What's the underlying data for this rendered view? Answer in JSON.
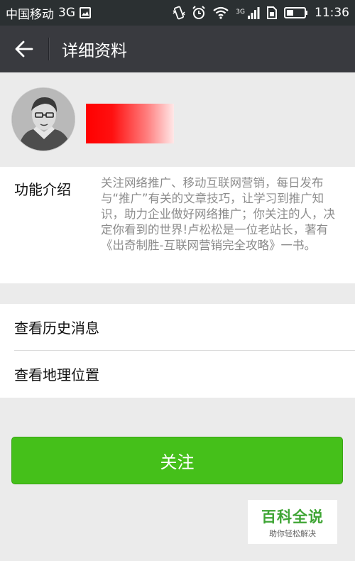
{
  "status_bar": {
    "carrier": "中国移动",
    "network": "3G",
    "signal_tech": "3G",
    "time": "11:36"
  },
  "title_bar": {
    "back_icon": "arrow-left-icon",
    "title": "详细资料"
  },
  "profile": {
    "avatar_description": "pencil-sketch portrait avatar",
    "name_redaction_color": "#ff0000"
  },
  "intro": {
    "label": "功能介绍",
    "text": "关注网络推广、移动互联网营销，每日发布与“推广”有关的文章技巧，让学习到推广知识，助力企业做好网络推广；你关注的人，决定你看到的世界!卢松松是一位老站长，著有《出奇制胜-互联网营销完全攻略》一书。"
  },
  "menu": {
    "history": "查看历史消息",
    "location": "查看地理位置"
  },
  "follow_button": {
    "label": "关注",
    "color": "#45c01a"
  },
  "watermark": {
    "title": "百科全说",
    "subtitle": "助你轻松解决"
  }
}
